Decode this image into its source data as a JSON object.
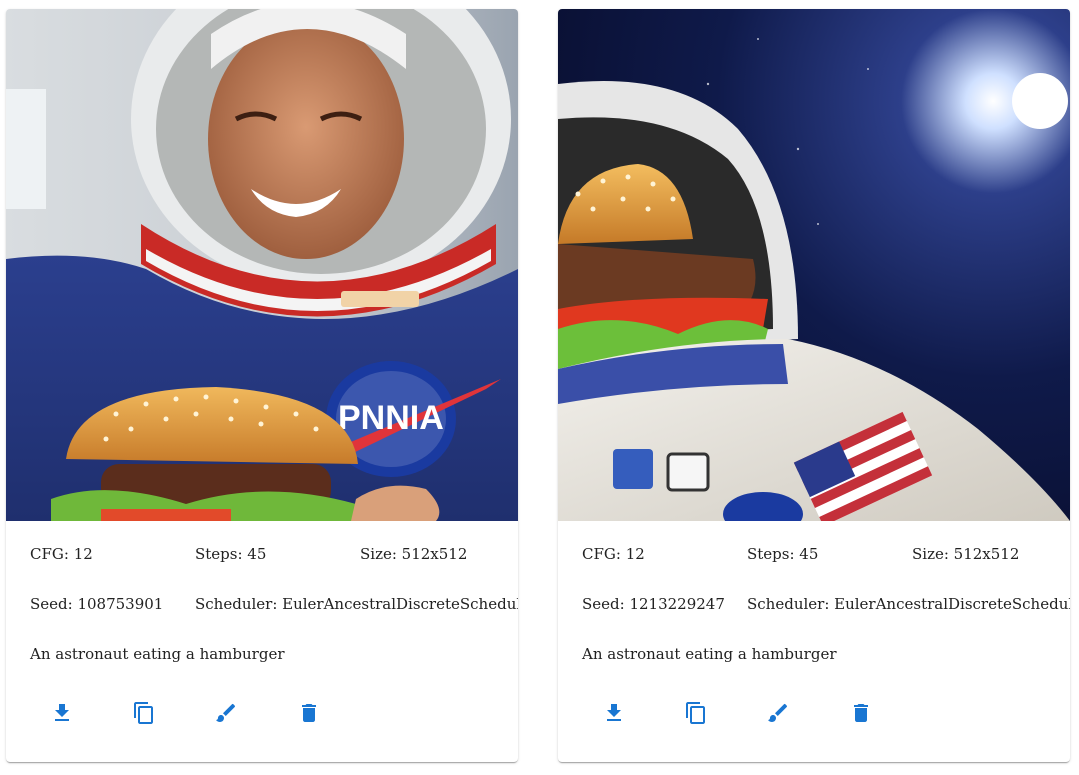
{
  "cards": [
    {
      "image_alt": "An astronaut eating a hamburger",
      "cfg": "CFG: 12",
      "steps": "Steps: 45",
      "size": "Size: 512x512",
      "seed": "Seed: 108753901",
      "scheduler": "Scheduler: EulerAncestralDiscreteScheduler",
      "prompt": "An astronaut eating a hamburger",
      "suit_text": "PNNIA",
      "actions": [
        {
          "name": "download",
          "icon": "download-icon"
        },
        {
          "name": "copy",
          "icon": "copy-icon"
        },
        {
          "name": "edit",
          "icon": "brush-icon"
        },
        {
          "name": "delete",
          "icon": "trash-icon"
        }
      ]
    },
    {
      "image_alt": "An astronaut eating a hamburger",
      "cfg": "CFG: 12",
      "steps": "Steps: 45",
      "size": "Size: 512x512",
      "seed": "Seed: 1213229247",
      "scheduler": "Scheduler: EulerAncestralDiscreteScheduler",
      "prompt": "An astronaut eating a hamburger",
      "actions": [
        {
          "name": "download",
          "icon": "download-icon"
        },
        {
          "name": "copy",
          "icon": "copy-icon"
        },
        {
          "name": "edit",
          "icon": "brush-icon"
        },
        {
          "name": "delete",
          "icon": "trash-icon"
        }
      ]
    }
  ],
  "colors": {
    "accent": "#1976d2",
    "text": "#222222"
  }
}
